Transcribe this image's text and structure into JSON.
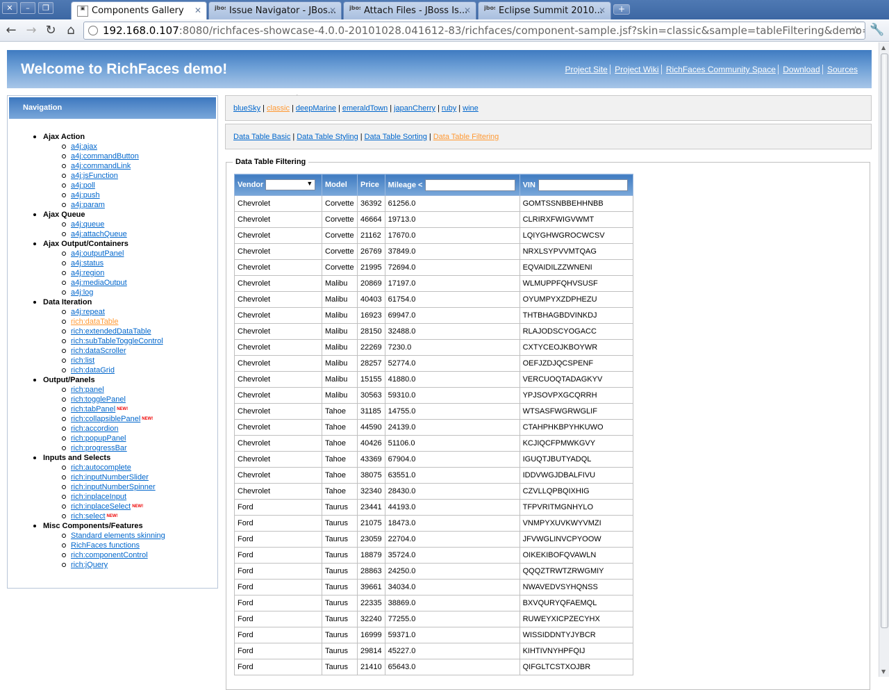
{
  "browser": {
    "tabs": [
      {
        "title": "Components Gallery",
        "favicon": "page-icon",
        "active": true
      },
      {
        "title": "Issue Navigator - JBos...",
        "favicon": "jboss-org-icon",
        "active": false
      },
      {
        "title": "Attach Files - JBoss Is...",
        "favicon": "jboss-org-icon",
        "active": false
      },
      {
        "title": "Eclipse Summit 2010...",
        "favicon": "jboss-org-icon",
        "active": false
      }
    ],
    "favicon_text": "jboss .org",
    "url_host": "192.168.0.107",
    "url_rest": ":8080/richfaces-showcase-4.0.0-20101028.041612-83/richfaces/component-sample.jsf?skin=classic&sample=tableFiltering&demo=dataTable"
  },
  "header": {
    "title": "Welcome to RichFaces demo!",
    "links": [
      "Project Site",
      "Project Wiki",
      "RichFaces Community Space",
      "Download",
      "Sources"
    ]
  },
  "navigation": {
    "title": "Navigation",
    "new_badge": "NEW!",
    "groups": [
      {
        "title": "Ajax Action",
        "items": [
          "a4j:ajax",
          "a4j:commandButton",
          "a4j:commandLink",
          "a4j:jsFunction",
          "a4j:poll",
          "a4j:push",
          "a4j:param"
        ]
      },
      {
        "title": "Ajax Queue",
        "items": [
          "a4j:queue",
          "a4j:attachQueue"
        ]
      },
      {
        "title": "Ajax Output/Containers",
        "items": [
          "a4j:outputPanel",
          "a4j:status",
          "a4j:region",
          "a4j:mediaOutput",
          "a4j:log"
        ]
      },
      {
        "title": "Data Iteration",
        "items": [
          "a4j:repeat",
          "rich:dataTable",
          "rich:extendedDataTable",
          "rich:subTableToggleControl",
          "rich:dataScroller",
          "rich:list",
          "rich:dataGrid"
        ]
      },
      {
        "title": "Output/Panels",
        "items": [
          "rich:panel",
          "rich:togglePanel",
          "rich:tabPanel",
          "rich:collapsiblePanel",
          "rich:accordion",
          "rich:popupPanel",
          "rich:progressBar"
        ]
      },
      {
        "title": "Inputs and Selects",
        "items": [
          "rich:autocomplete",
          "rich:inputNumberSlider",
          "rich:inputNumberSpinner",
          "rich:inplaceInput",
          "rich:inplaceSelect",
          "rich:select"
        ]
      },
      {
        "title": "Misc Components/Features",
        "items": [
          "Standard elements skinning",
          "RichFaces functions",
          "rich:componentControl",
          "rich:jQuery"
        ]
      }
    ],
    "selected": "rich:dataTable",
    "new_items": [
      "rich:tabPanel",
      "rich:collapsiblePanel",
      "rich:inplaceSelect",
      "rich:select"
    ]
  },
  "skins": {
    "items": [
      "blueSky",
      "classic",
      "deepMarine",
      "emeraldTown",
      "japanCherry",
      "ruby",
      "wine"
    ],
    "selected": "classic"
  },
  "demos": {
    "items": [
      "Data Table Basic",
      "Data Table Styling",
      "Data Table Sorting",
      "Data Table Filtering"
    ],
    "selected": "Data Table Filtering"
  },
  "panel_title": "Data Table Filtering",
  "table": {
    "headers": {
      "vendor": "Vendor",
      "model": "Model",
      "price": "Price",
      "mileage": "Mileage <",
      "vin": "VIN"
    },
    "vendor_filter_value": "",
    "mileage_filter_value": "",
    "vin_filter_value": "",
    "rows": [
      [
        "Chevrolet",
        "Corvette",
        "36392",
        "61256.0",
        "GOMTSSNBBEHHNBB"
      ],
      [
        "Chevrolet",
        "Corvette",
        "46664",
        "19713.0",
        "CLRIRXFWIGVWMT"
      ],
      [
        "Chevrolet",
        "Corvette",
        "21162",
        "17670.0",
        "LQIYGHWGROCWCSV"
      ],
      [
        "Chevrolet",
        "Corvette",
        "26769",
        "37849.0",
        "NRXLSYPVVMTQAG"
      ],
      [
        "Chevrolet",
        "Corvette",
        "21995",
        "72694.0",
        "EQVAIDILZZWNENI"
      ],
      [
        "Chevrolet",
        "Malibu",
        "20869",
        "17197.0",
        "WLMUPPFQHVSUSF"
      ],
      [
        "Chevrolet",
        "Malibu",
        "40403",
        "61754.0",
        "OYUMPYXZDPHEZU"
      ],
      [
        "Chevrolet",
        "Malibu",
        "16923",
        "69947.0",
        "THTBHAGBDVINKDJ"
      ],
      [
        "Chevrolet",
        "Malibu",
        "28150",
        "32488.0",
        "RLAJODSCYOGACC"
      ],
      [
        "Chevrolet",
        "Malibu",
        "22269",
        "7230.0",
        "CXTYCEOJKBOYWR"
      ],
      [
        "Chevrolet",
        "Malibu",
        "28257",
        "52774.0",
        "OEFJZDJQCSPENF"
      ],
      [
        "Chevrolet",
        "Malibu",
        "15155",
        "41880.0",
        "VERCUOQTADAGKYV"
      ],
      [
        "Chevrolet",
        "Malibu",
        "30563",
        "59310.0",
        "YPJSOVPXGCQRRH"
      ],
      [
        "Chevrolet",
        "Tahoe",
        "31185",
        "14755.0",
        "WTSASFWGRWGLIF"
      ],
      [
        "Chevrolet",
        "Tahoe",
        "44590",
        "24139.0",
        "CTAHPHKBPYHKUWO"
      ],
      [
        "Chevrolet",
        "Tahoe",
        "40426",
        "51106.0",
        "KCJIQCFPMWKGVY"
      ],
      [
        "Chevrolet",
        "Tahoe",
        "43369",
        "67904.0",
        "IGUQTJBUTYADQL"
      ],
      [
        "Chevrolet",
        "Tahoe",
        "38075",
        "63551.0",
        "IDDVWGJDBALFIVU"
      ],
      [
        "Chevrolet",
        "Tahoe",
        "32340",
        "28430.0",
        "CZVLLQPBQIXHIG"
      ],
      [
        "Ford",
        "Taurus",
        "23441",
        "44193.0",
        "TFPVRITMGNHYLO"
      ],
      [
        "Ford",
        "Taurus",
        "21075",
        "18473.0",
        "VNMPYXUVKWYVMZI"
      ],
      [
        "Ford",
        "Taurus",
        "23059",
        "22704.0",
        "JFVWGLINVCPYOOW"
      ],
      [
        "Ford",
        "Taurus",
        "18879",
        "35724.0",
        "OIKEKIBOFQVAWLN"
      ],
      [
        "Ford",
        "Taurus",
        "28863",
        "24250.0",
        "QQQZTRWTZRWGMIY"
      ],
      [
        "Ford",
        "Taurus",
        "39661",
        "34034.0",
        "NWAVEDVSYHQNSS"
      ],
      [
        "Ford",
        "Taurus",
        "22335",
        "38869.0",
        "BXVQURYQFAEMQL"
      ],
      [
        "Ford",
        "Taurus",
        "32240",
        "77255.0",
        "RUWEYXICPZECYHX"
      ],
      [
        "Ford",
        "Taurus",
        "16999",
        "59371.0",
        "WISSIDDNTYJYBCR"
      ],
      [
        "Ford",
        "Taurus",
        "29814",
        "45227.0",
        "KIHTIVNYHPFQIJ"
      ],
      [
        "Ford",
        "Taurus",
        "21410",
        "65643.0",
        "QIFGLTCSTXOJBR"
      ]
    ]
  },
  "colors": {
    "link": "#0066cc",
    "selected_link": "#ff9933",
    "header_gradient_top": "#3f7bc1",
    "header_gradient_bottom": "#a8c6e8",
    "new_badge": "#ee0000"
  }
}
